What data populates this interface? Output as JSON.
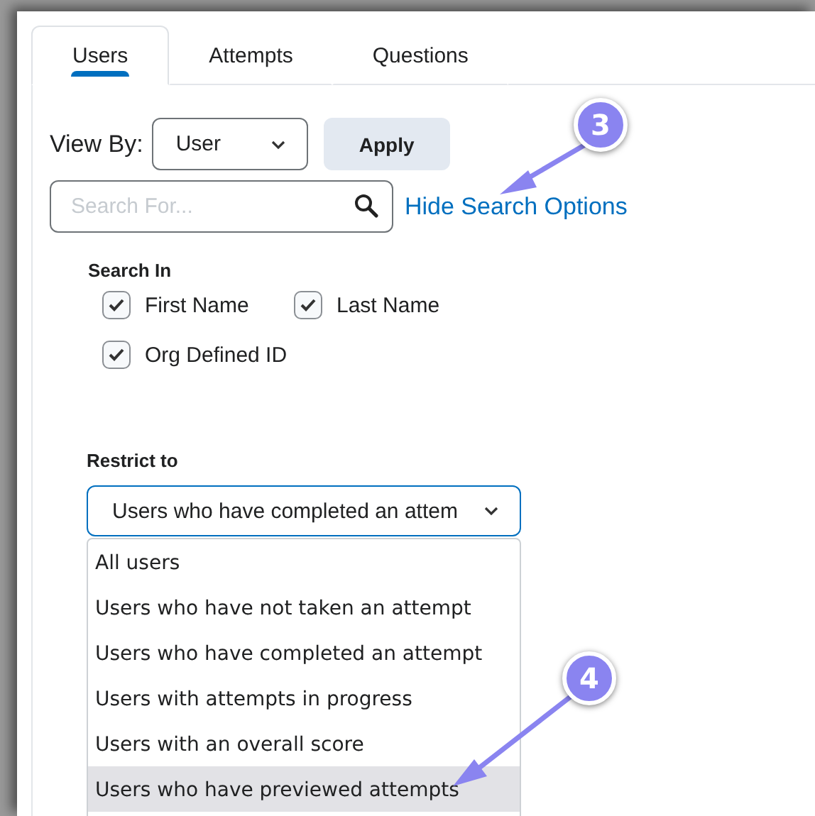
{
  "tabs": [
    {
      "label": "Users",
      "selected": true
    },
    {
      "label": "Attempts",
      "selected": false
    },
    {
      "label": "Questions",
      "selected": false
    }
  ],
  "view_by": {
    "label": "View By:",
    "value": "User",
    "apply": "Apply"
  },
  "search": {
    "placeholder": "Search For...",
    "toggle_link": "Hide Search Options"
  },
  "search_in": {
    "heading": "Search In",
    "options": [
      {
        "label": "First Name",
        "checked": true
      },
      {
        "label": "Last Name",
        "checked": true
      },
      {
        "label": "Org Defined ID",
        "checked": true
      }
    ]
  },
  "restrict_to": {
    "heading": "Restrict to",
    "value": "Users who have completed an attem",
    "expanded": true,
    "options": [
      {
        "label": "All users",
        "selected": false
      },
      {
        "label": "Users who have not taken an attempt",
        "selected": false
      },
      {
        "label": "Users who have completed an attempt",
        "selected": false
      },
      {
        "label": "Users with attempts in progress",
        "selected": false
      },
      {
        "label": "Users with an overall score",
        "selected": false
      },
      {
        "label": "Users who have previewed attempts",
        "selected": true
      }
    ]
  },
  "callouts": [
    {
      "number": "3"
    },
    {
      "number": "4"
    }
  ]
}
